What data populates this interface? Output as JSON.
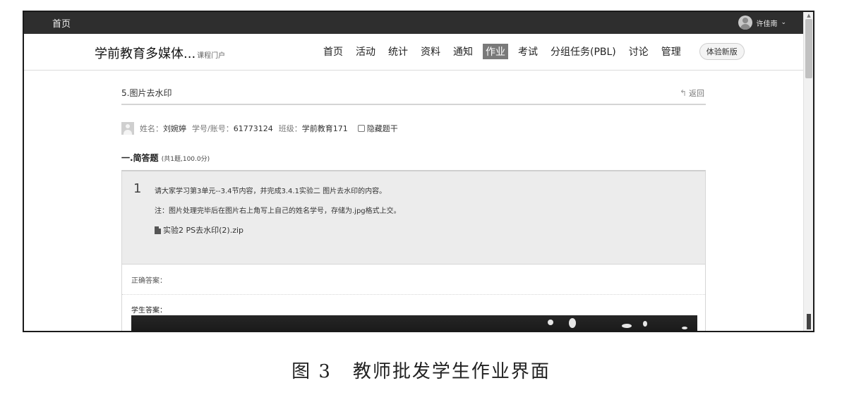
{
  "topbar": {
    "home_label": "首页",
    "user_name": "许佳南",
    "user_chevron": "⌄"
  },
  "navbar": {
    "course_title": "学前教育多媒体...",
    "course_subtitle": "课程门户",
    "items": [
      "首页",
      "活动",
      "统计",
      "资料",
      "通知",
      "作业",
      "考试",
      "分组任务(PBL)",
      "讨论",
      "管理"
    ],
    "active_item": "作业",
    "try_new_label": "体验新版"
  },
  "homework": {
    "title": "5.图片去水印",
    "back_label": "返回",
    "back_icon": "reply-arrow-icon"
  },
  "student": {
    "name_label": "姓名：",
    "name": "刘婉婷",
    "id_label": "学号/账号：",
    "id": "61773124",
    "class_label": "班级：",
    "class": "学前教育171",
    "hide_question_label": "隐藏题干"
  },
  "section": {
    "title": "一.简答题",
    "subtitle": "(共1题,100.0分)"
  },
  "question": {
    "number": "1",
    "line1": "请大家学习第3单元--3.4节内容，并完成3.4.1实验二 图片去水印的内容。",
    "line2": "注：图片处理完毕后在图片右上角写上自己的姓名学号，存储为.jpg格式上交。",
    "attachment": "实验2 PS去水印(2).zip"
  },
  "answers": {
    "correct_label": "正确答案：",
    "student_label": "学生答案："
  },
  "caption": {
    "figure": "图 3",
    "text": "教师批发学生作业界面"
  },
  "colors": {
    "topbar_bg": "#2e2e2e",
    "active_nav_bg": "#7a7a7a",
    "question_bg": "#ececec"
  }
}
